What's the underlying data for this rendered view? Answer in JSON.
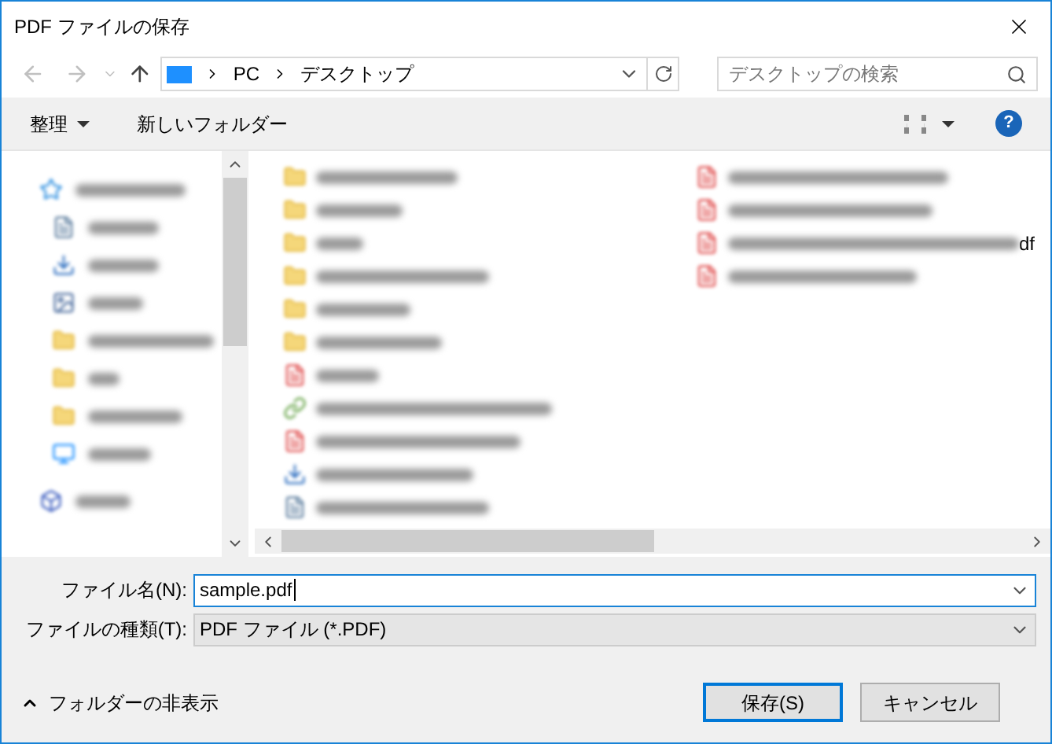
{
  "window": {
    "title": "PDF ファイルの保存"
  },
  "address": {
    "segments": [
      "PC",
      "デスクトップ"
    ]
  },
  "search": {
    "placeholder": "デスクトップの検索"
  },
  "toolbar": {
    "organize": "整理",
    "new_folder": "新しいフォルダー",
    "help": "?"
  },
  "nav_items": [
    {
      "kind": "star"
    },
    {
      "kind": "doc"
    },
    {
      "kind": "download"
    },
    {
      "kind": "picture"
    },
    {
      "kind": "folder"
    },
    {
      "kind": "folder"
    },
    {
      "kind": "folder"
    },
    {
      "kind": "desktop"
    },
    {
      "kind": "box"
    }
  ],
  "files_col1": [
    {
      "kind": "folder"
    },
    {
      "kind": "folder"
    },
    {
      "kind": "folder"
    },
    {
      "kind": "folder"
    },
    {
      "kind": "folder"
    },
    {
      "kind": "folder"
    },
    {
      "kind": "pdf"
    },
    {
      "kind": "shortcut"
    },
    {
      "kind": "pdf"
    },
    {
      "kind": "download"
    },
    {
      "kind": "doc"
    }
  ],
  "files_col2": [
    {
      "kind": "pdf"
    },
    {
      "kind": "pdf"
    },
    {
      "kind": "pdf",
      "tail": "df"
    },
    {
      "kind": "pdf"
    }
  ],
  "file_name": {
    "label": "ファイル名(N):",
    "value": "sample.pdf"
  },
  "file_type": {
    "label": "ファイルの種類(T):",
    "value": "PDF ファイル (*.PDF)"
  },
  "hide_folders": "フォルダーの非表示",
  "buttons": [
    {
      "label": "保存(S)",
      "default": true
    },
    {
      "label": "キャンセル",
      "default": false
    }
  ]
}
